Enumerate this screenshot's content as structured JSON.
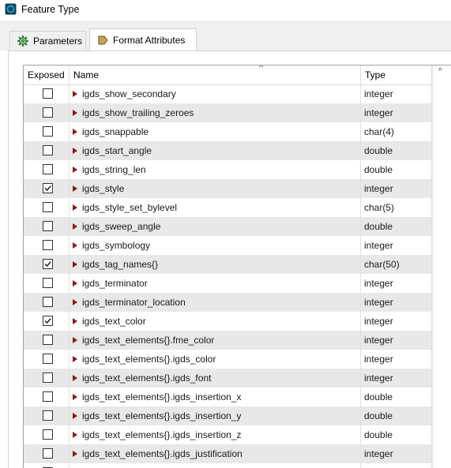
{
  "window": {
    "title": "Feature Type"
  },
  "tabs": [
    {
      "label": "Parameters",
      "icon": "gear-icon",
      "active": false
    },
    {
      "label": "Format Attributes",
      "icon": "attribute-tag-icon",
      "active": true
    }
  ],
  "table": {
    "columns": {
      "exposed": "Exposed",
      "name": "Name",
      "type": "Type"
    },
    "sort_indicator": "^",
    "rows": [
      {
        "exposed": false,
        "name": "igds_show_secondary",
        "type": "integer"
      },
      {
        "exposed": false,
        "name": "igds_show_trailing_zeroes",
        "type": "integer"
      },
      {
        "exposed": false,
        "name": "igds_snappable",
        "type": "char(4)"
      },
      {
        "exposed": false,
        "name": "igds_start_angle",
        "type": "double"
      },
      {
        "exposed": false,
        "name": "igds_string_len",
        "type": "double"
      },
      {
        "exposed": true,
        "name": "igds_style",
        "type": "integer"
      },
      {
        "exposed": false,
        "name": "igds_style_set_bylevel",
        "type": "char(5)"
      },
      {
        "exposed": false,
        "name": "igds_sweep_angle",
        "type": "double"
      },
      {
        "exposed": false,
        "name": "igds_symbology",
        "type": "integer"
      },
      {
        "exposed": true,
        "name": "igds_tag_names{}",
        "type": "char(50)"
      },
      {
        "exposed": false,
        "name": "igds_terminator",
        "type": "integer"
      },
      {
        "exposed": false,
        "name": "igds_terminator_location",
        "type": "integer"
      },
      {
        "exposed": true,
        "name": "igds_text_color",
        "type": "integer"
      },
      {
        "exposed": false,
        "name": "igds_text_elements{}.fme_color",
        "type": "integer"
      },
      {
        "exposed": false,
        "name": "igds_text_elements{}.igds_color",
        "type": "integer"
      },
      {
        "exposed": false,
        "name": "igds_text_elements{}.igds_font",
        "type": "integer"
      },
      {
        "exposed": false,
        "name": "igds_text_elements{}.igds_insertion_x",
        "type": "double"
      },
      {
        "exposed": false,
        "name": "igds_text_elements{}.igds_insertion_y",
        "type": "double"
      },
      {
        "exposed": false,
        "name": "igds_text_elements{}.igds_insertion_z",
        "type": "double"
      },
      {
        "exposed": false,
        "name": "igds_text_elements{}.igds_justification",
        "type": "integer"
      },
      {
        "exposed": false,
        "name": "",
        "type": ""
      }
    ]
  },
  "colors": {
    "row_alt": "#e8e8e8",
    "expand_arrow": "#8b1a1a",
    "app_icon": "#1aa0c8"
  }
}
